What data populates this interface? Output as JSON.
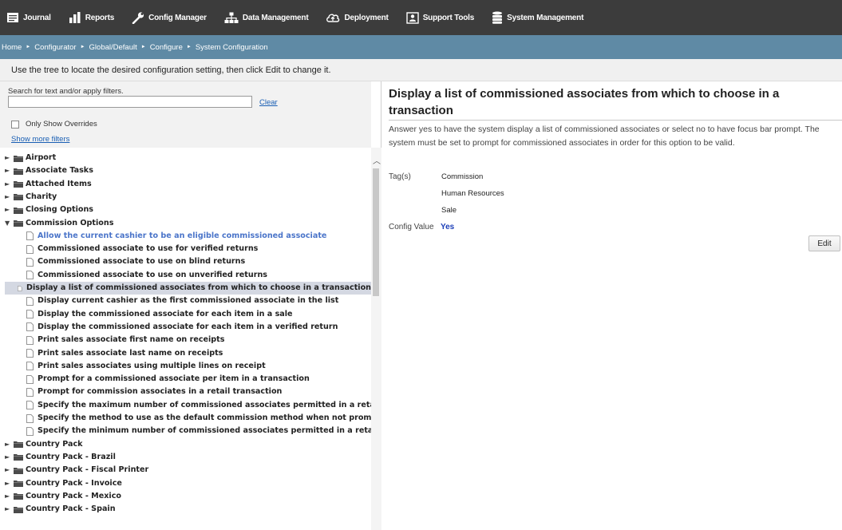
{
  "nav": {
    "items": [
      {
        "label": "Journal",
        "icon": "journal-icon"
      },
      {
        "label": "Reports",
        "icon": "bar-chart-icon"
      },
      {
        "label": "Config Manager",
        "icon": "wrench-icon"
      },
      {
        "label": "Data Management",
        "icon": "hierarchy-icon"
      },
      {
        "label": "Deployment",
        "icon": "cloud-upload-icon"
      },
      {
        "label": "Support Tools",
        "icon": "support-tools-icon"
      },
      {
        "label": "System Management",
        "icon": "database-icon"
      }
    ]
  },
  "breadcrumb": [
    "Home",
    "Configurator",
    "Global/Default",
    "Configure",
    "System Configuration"
  ],
  "instruction": "Use the tree to locate the desired configuration setting, then click Edit to change it.",
  "filters": {
    "search_label": "Search for text and/or apply filters.",
    "search_value": "",
    "clear_label": "Clear",
    "overrides_label": "Only Show Overrides",
    "overrides_checked": false,
    "more_filters_label": "Show more filters"
  },
  "tree": {
    "categories_before": [
      "Airport",
      "Associate Tasks",
      "Attached Items",
      "Charity",
      "Closing Options"
    ],
    "expanded_category": "Commission Options",
    "settings": [
      "Allow the current cashier to be an eligible commissioned associate",
      "Commissioned associate to use for verified returns",
      "Commissioned associate to use on blind returns",
      "Commissioned associate to use on unverified returns",
      "Display a list of commissioned associates from which to choose in a transaction",
      "Display current cashier as the first commissioned associate in the list",
      "Display the commissioned associate for each item in a sale",
      "Display the commissioned associate for each item in a verified return",
      "Print sales associate first name on receipts",
      "Print sales associate last name on receipts",
      "Print sales associates using multiple lines on receipt",
      "Prompt for a commissioned associate per item in a transaction",
      "Prompt for commission associates in a retail transaction",
      "Specify the maximum number of commissioned associates permitted in a retail t",
      "Specify the method to use as the default commission method when not promptin",
      "Specify the minimum number of commissioned associates permitted in a retail tr"
    ],
    "highlighted_index": 0,
    "selected_index": 4,
    "categories_after": [
      "Country Pack",
      "Country Pack - Brazil",
      "Country Pack - Fiscal Printer",
      "Country Pack - Invoice",
      "Country Pack - Mexico",
      "Country Pack - Spain"
    ]
  },
  "detail": {
    "title": "Display a list of commissioned associates from which to choose in a transaction",
    "description": "Answer yes to have the system display a list of commissioned associates or select no to have focus bar prompt. The system must be set to prompt for commissioned associates in order for this option to be valid.",
    "tags_label": "Tag(s)",
    "tags": [
      "Commission",
      "Human Resources",
      "Sale"
    ],
    "config_label": "Config Value",
    "config_value": "Yes",
    "edit_label": "Edit"
  },
  "colors": {
    "nav_bg": "#3c3c3c",
    "breadcrumb_bg": "#5f8aa5",
    "link": "#1a5fb4",
    "config_value": "#1d3fb8",
    "highlight_text": "#4a74c9",
    "selected_row": "#d4d8e2"
  }
}
